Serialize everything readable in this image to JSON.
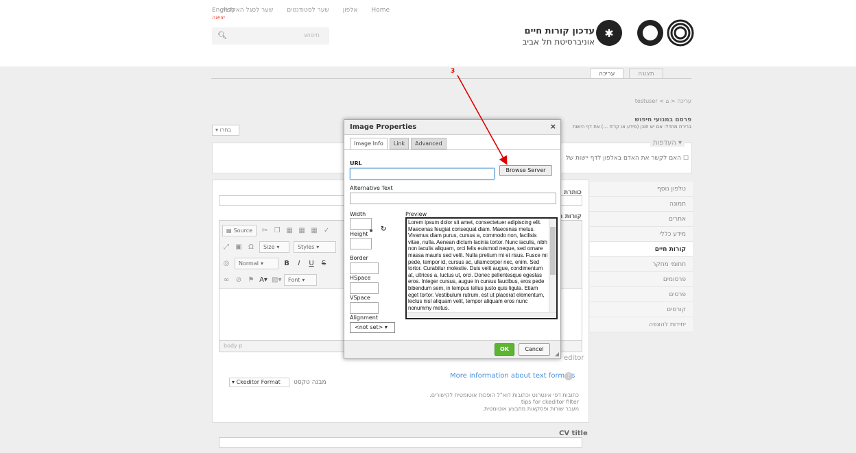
{
  "header": {
    "top_links": [
      "Home",
      "אלפון",
      "שער לסטודנטים",
      "שער לסגל האקדמי"
    ],
    "english_link": "English",
    "logout_link": "יציאה",
    "search_placeholder": "חיפוש",
    "search_icon": "search-icon",
    "logo_line1": "עדכון קורות חיים",
    "logo_line2": "אוניברסיטת תל אביב"
  },
  "page_tabs": {
    "view": "תצוגה",
    "edit": "עריכה"
  },
  "breadcrumb": "עריכה < ⌂ > testuser",
  "publish": {
    "title": "פרסם במנועי חיפוש",
    "subtitle": "ברירת מחדל: אם יש תוכן (מידע או קו\"ח ...) את דף הישות",
    "select_value": "בחרו"
  },
  "preferences": {
    "legend": "העדפות",
    "question": "האם לקשר את האדם באלפון לדף יישות של"
  },
  "form": {
    "title_label": "כותרת",
    "cv_label": "קורות ח",
    "path_bar": "body  p",
    "editor_suffix": "editor",
    "more_info": "More information about text formats",
    "format_select": "Ckeditor Format",
    "format_label": "מבנה טקסט",
    "format_note1": "כתובות דפי אינטרנט וכתובות דוא\"ל הופכות אוטומטית לקישורים.",
    "format_note2": "tips for ckeditor filter",
    "format_note3": "מעבר שורות ופסקאות מתבצע אוטומטית.",
    "cv_title_label": "CV title"
  },
  "toolbar": {
    "source": "Source",
    "size": "Size",
    "styles": "Styles",
    "normal": "Normal",
    "font": "Font",
    "bold": "B",
    "italic": "I",
    "underline": "U",
    "strike": "S"
  },
  "sidenav": {
    "items": [
      "טלפון נוסף",
      "תמונה",
      "אתרים",
      "מידע כללי",
      "קורות חיים",
      "תחומי מחקר",
      "פרסומים",
      "פרסים",
      "קורסים",
      "יחידות להצפה"
    ],
    "active_index": 4
  },
  "dialog": {
    "title": "Image Properties",
    "close": "×",
    "tabs": [
      "Image Info",
      "Link",
      "Advanced"
    ],
    "url_label": "URL",
    "url_value": "",
    "browse_label": "Browse Server",
    "alt_label": "Alternative Text",
    "width_label": "Width",
    "height_label": "Height",
    "border_label": "Border",
    "hspace_label": "HSpace",
    "vspace_label": "VSpace",
    "alignment_label": "Alignment",
    "alignment_value": "<not set>",
    "preview_label": "Preview",
    "preview_text": "Lorem ipsum dolor sit amet, consectetuer adipiscing elit. Maecenas feugiat consequat diam. Maecenas metus. Vivamus diam purus, cursus a, commodo non, facilisis vitae, nulla. Aenean dictum lacinia tortor. Nunc iaculis, nibh non iaculis aliquam, orci felis euismod neque, sed ornare massa mauris sed velit. Nulla pretium mi et risus. Fusce mi pede, tempor id, cursus ac, ullamcorper nec, enim. Sed tortor. Curabitur molestie. Duis velit augue, condimentum at, ultrices a, luctus ut, orci. Donec pellentesque egestas eros. Integer cursus, augue in cursus faucibus, eros pede bibendum sem, in tempus tellus justo quis ligula. Etiam eget tortor. Vestibulum rutrum, est ut placerat elementum, lectus nisl aliquam velit, tempor aliquam eros nunc nonummy metus.",
    "ok_label": "OK",
    "cancel_label": "Cancel"
  },
  "annotation": {
    "number": "3",
    "color": "#e00000"
  }
}
